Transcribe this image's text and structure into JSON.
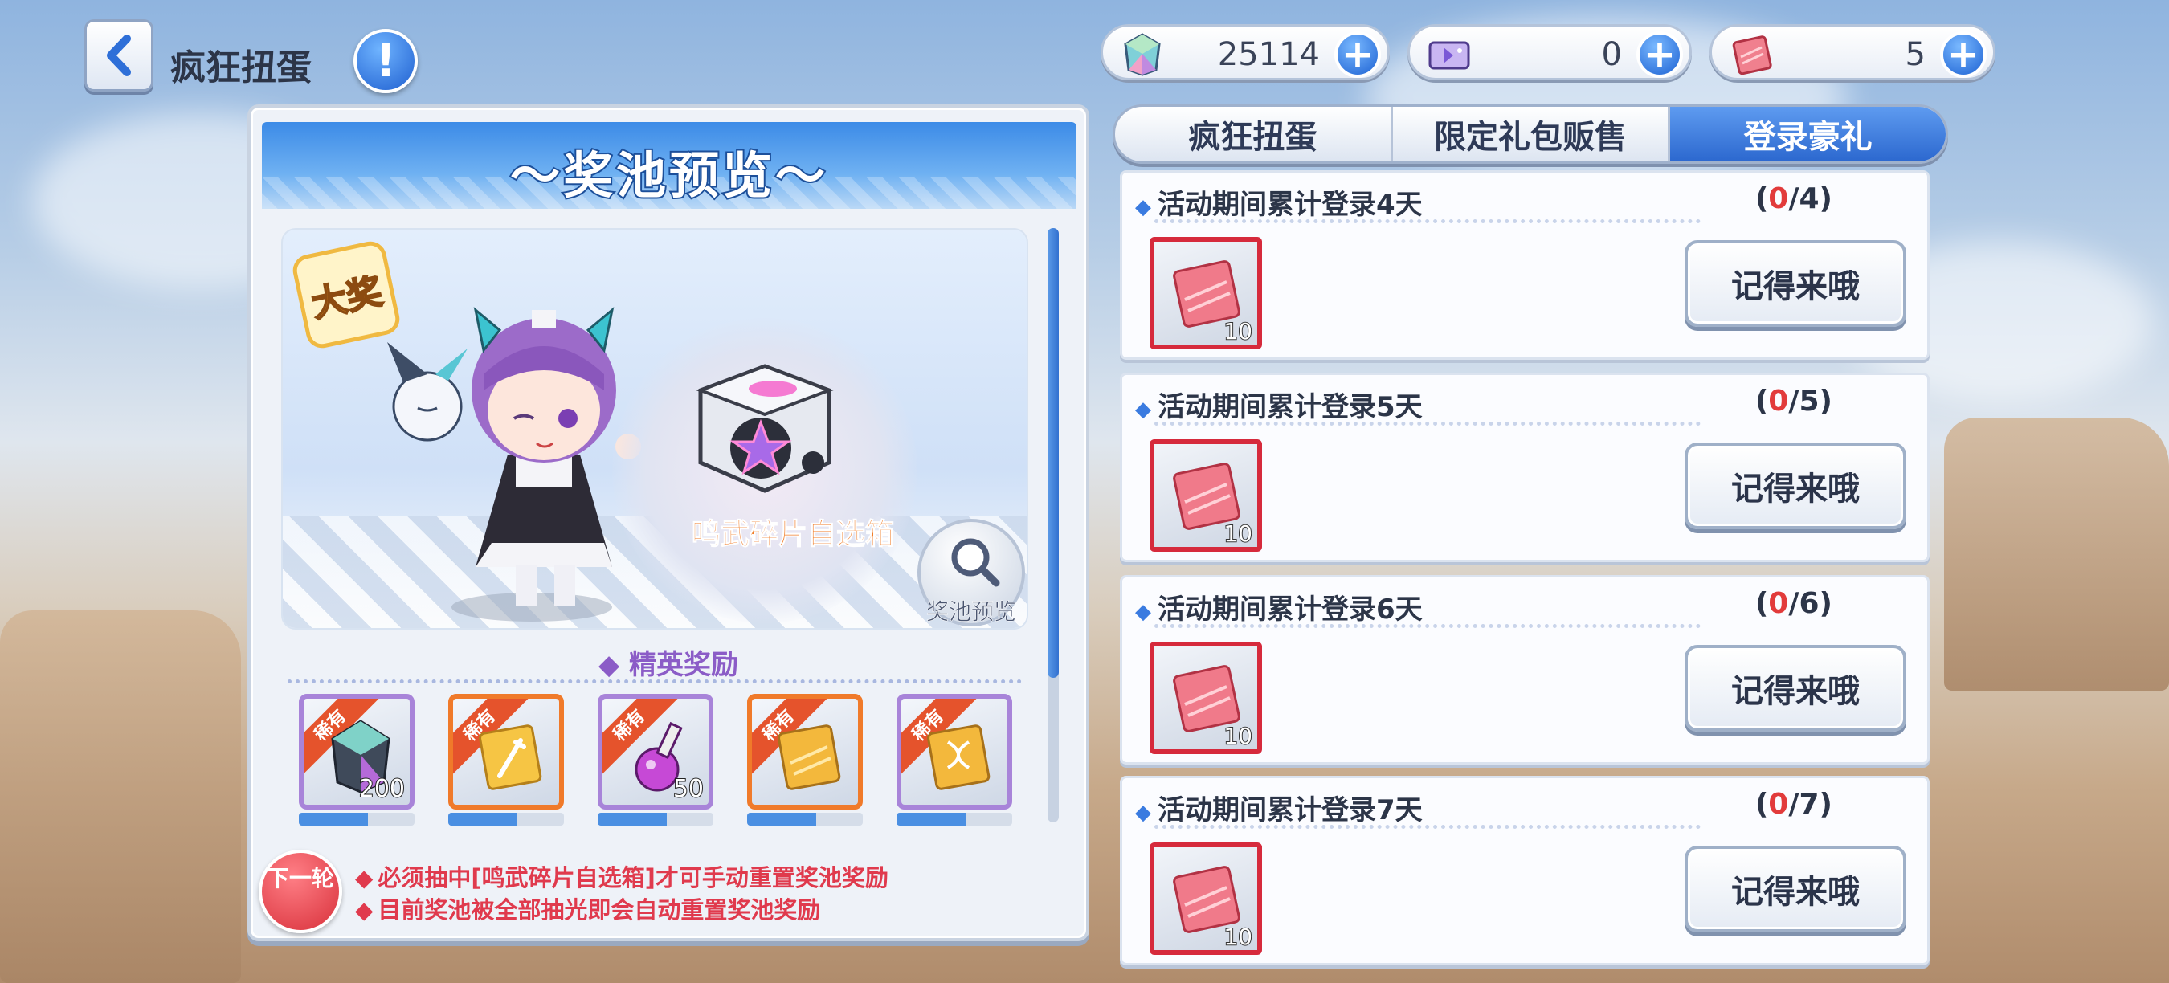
{
  "header": {
    "title": "疯狂扭蛋",
    "info_glyph": "!"
  },
  "currencies": [
    {
      "icon": "gem-icon",
      "value": "25114"
    },
    {
      "icon": "ticket-icon",
      "value": "0"
    },
    {
      "icon": "shard-card-icon",
      "value": "5"
    }
  ],
  "pool": {
    "title": "～奖池预览～",
    "grand_prize_badge": "大奖",
    "grand_prize_name": "鸣武碎片自选箱",
    "preview_button_label": "奖池预览",
    "elite_label": "◆ 精英奖励",
    "elite_items": [
      {
        "tag": "稀有",
        "quantity": "200",
        "icon": "crystal-icon",
        "frame": "purple"
      },
      {
        "tag": "稀有",
        "quantity": "",
        "icon": "sword-card-icon",
        "frame": "orange"
      },
      {
        "tag": "稀有",
        "quantity": "50",
        "icon": "potion-icon",
        "frame": "purple"
      },
      {
        "tag": "稀有",
        "quantity": "",
        "icon": "gold-card-icon",
        "frame": "orange"
      },
      {
        "tag": "稀有",
        "quantity": "",
        "icon": "dna-card-icon",
        "frame": "purple"
      }
    ],
    "next_round_label": "下一轮",
    "notes": [
      "必须抽中[鸣武碎片自选箱]才可手动重置奖池奖励",
      "目前奖池被全部抽光即会自动重置奖池奖励"
    ]
  },
  "tabs": [
    {
      "label": "疯狂扭蛋",
      "active": false
    },
    {
      "label": "限定礼包贩售",
      "active": false
    },
    {
      "label": "登录豪礼",
      "active": true
    }
  ],
  "login_rewards": [
    {
      "task": "活动期间累计登录4天",
      "current": "0",
      "total": "/4",
      "item_qty": "10",
      "button": "记得来哦"
    },
    {
      "task": "活动期间累计登录5天",
      "current": "0",
      "total": "/5",
      "item_qty": "10",
      "button": "记得来哦"
    },
    {
      "task": "活动期间累计登录6天",
      "current": "0",
      "total": "/6",
      "item_qty": "10",
      "button": "记得来哦"
    },
    {
      "task": "活动期间累计登录7天",
      "current": "0",
      "total": "/7",
      "item_qty": "10",
      "button": "记得来哦"
    }
  ],
  "colors": {
    "accent_blue": "#2c68cf",
    "item_border_red": "#d62a3c",
    "note_red": "#e03a4d",
    "elite_purple": "#8b5cc7"
  }
}
